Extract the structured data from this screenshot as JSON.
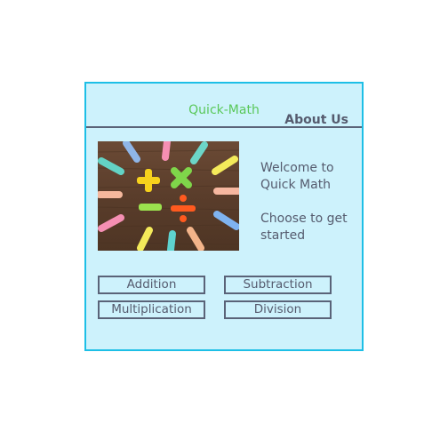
{
  "header": {
    "title": "Quick-Math",
    "about_label": "About Us"
  },
  "welcome": {
    "line1": "Welcome to Quick Math",
    "line2": "Choose to get started"
  },
  "operations": {
    "addition": "Addition",
    "subtraction": "Subtraction",
    "multiplication": "Multiplication",
    "division": "Division"
  },
  "colors": {
    "frame_border": "#1dbfe6",
    "frame_background": "#cdf2fc",
    "title_text": "#5ac85a",
    "body_text": "#555b6e"
  }
}
